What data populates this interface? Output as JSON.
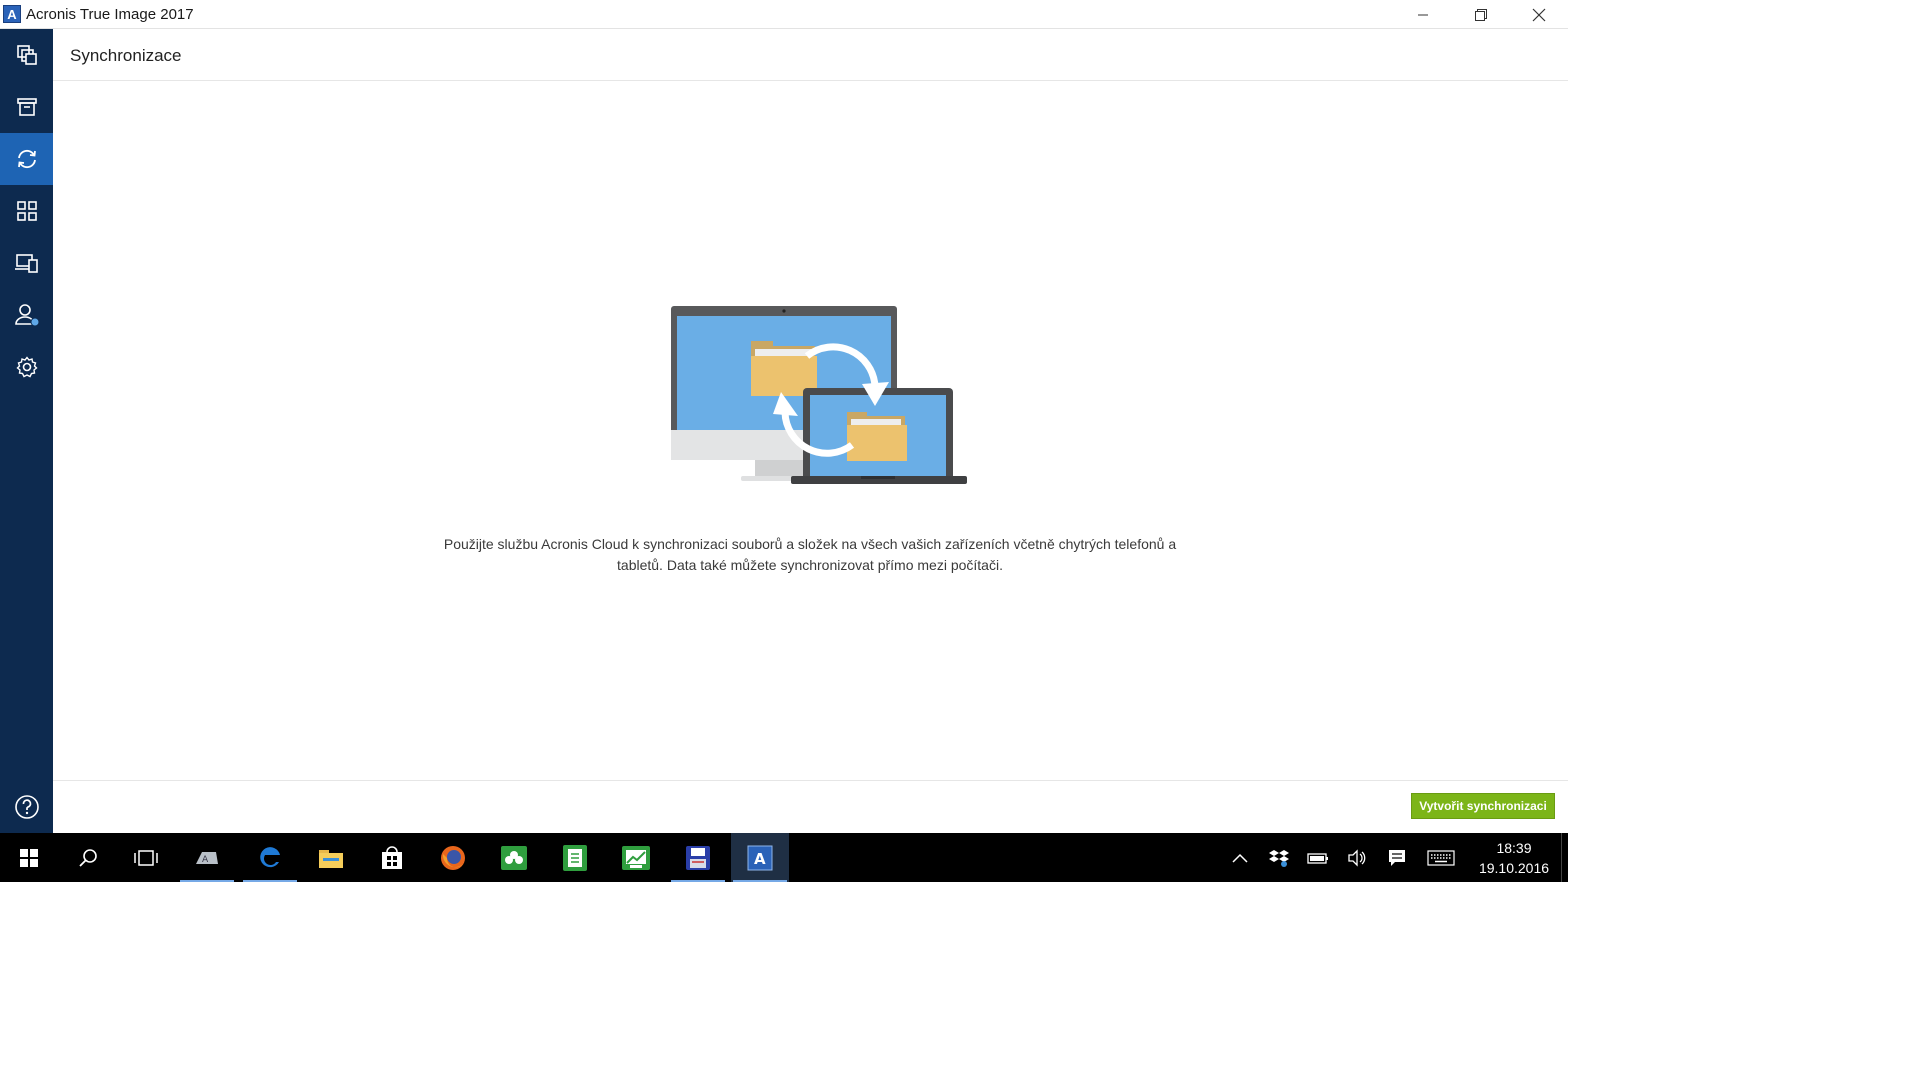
{
  "window": {
    "title": "Acronis True Image 2017",
    "logo_letter": "A"
  },
  "sidebar": {
    "items": [
      {
        "icon": "backup-icon",
        "active": false
      },
      {
        "icon": "archive-icon",
        "active": false
      },
      {
        "icon": "sync-icon",
        "active": true
      },
      {
        "icon": "tools-icon",
        "active": false
      },
      {
        "icon": "devices-icon",
        "active": false
      },
      {
        "icon": "account-icon",
        "active": false
      },
      {
        "icon": "settings-icon",
        "active": false
      }
    ],
    "help_icon": "help-icon"
  },
  "main": {
    "title": "Synchronizace",
    "description": "Použijte službu Acronis Cloud k synchronizaci souborů a složek na všech vašich zařízeních včetně chytrých telefonů a tabletů. Data také můžete synchronizovat přímo mezi počítači.",
    "create_button": "Vytvořit synchronizaci"
  },
  "colors": {
    "sidebar": "#0d2a4f",
    "accent": "#1e64b4",
    "button": "#7cb518"
  },
  "taskbar": {
    "apps": [
      "start-icon",
      "search-icon",
      "task-view-icon",
      "language-app-icon",
      "edge-icon",
      "file-explorer-icon",
      "store-icon",
      "firefox-icon",
      "green-app-icon",
      "notes-app-icon",
      "image-app-icon",
      "save-app-icon",
      "acronis-icon"
    ],
    "time": "18:39",
    "date": "19.10.2016"
  }
}
